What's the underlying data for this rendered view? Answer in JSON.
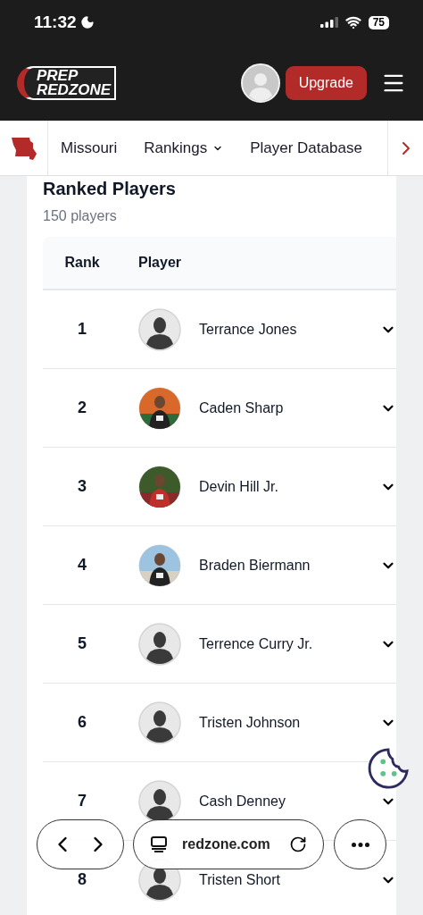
{
  "status_bar": {
    "time": "11:32",
    "battery": "75"
  },
  "header": {
    "logo": [
      "PREP",
      "REDZONE"
    ],
    "upgrade_button": "Upgrade"
  },
  "nav": {
    "items": [
      {
        "label": "Missouri",
        "dropdown": false
      },
      {
        "label": "Rankings",
        "dropdown": true
      },
      {
        "label": "Player Database",
        "dropdown": false
      }
    ]
  },
  "card": {
    "title": "Ranked Players",
    "subtitle": "150 players"
  },
  "table": {
    "columns": [
      "Rank",
      "Player"
    ],
    "rows": [
      {
        "rank": "1",
        "name": "Terrance Jones",
        "kind": "silhouette"
      },
      {
        "rank": "2",
        "name": "Caden Sharp"
      },
      {
        "rank": "3",
        "name": "Devin Hill Jr."
      },
      {
        "rank": "4",
        "name": "Braden Biermann"
      },
      {
        "rank": "5",
        "name": "Terrence Curry Jr.",
        "kind": "silhouette"
      },
      {
        "rank": "6",
        "name": "Tristen Johnson",
        "kind": "silhouette"
      },
      {
        "rank": "7",
        "name": "Cash Denney",
        "kind": "silhouette"
      },
      {
        "rank": "8",
        "name": "Tristen Short",
        "kind": "silhouette"
      }
    ]
  },
  "browser_bar": {
    "url": "redzone.com"
  }
}
